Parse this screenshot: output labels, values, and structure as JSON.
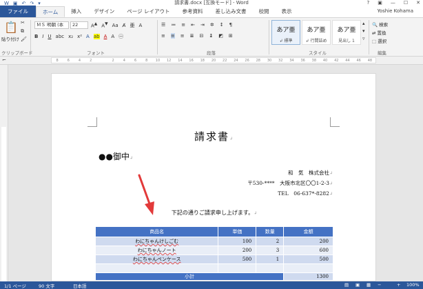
{
  "window": {
    "title": "請求書.docx [互換モード] - Word",
    "user": "Yoshie Kohama",
    "qat_icons": [
      "word-icon",
      "save-icon",
      "undo-icon",
      "redo-icon",
      "customize-icon"
    ],
    "buttons": {
      "help": "?",
      "ribbon_options": "▣",
      "minimize": "—",
      "maximize": "☐",
      "close": "✕"
    }
  },
  "ribbon": {
    "tabs": [
      "ファイル",
      "ホーム",
      "挿入",
      "デザイン",
      "ページ レイアウト",
      "参考資料",
      "差し込み文書",
      "校閲",
      "表示"
    ],
    "active_tab": "ホーム",
    "clipboard": {
      "paste_label": "貼り付け",
      "group_label": "クリップボード"
    },
    "font": {
      "name": "ＭＳ 明朝 (本",
      "size": "22",
      "group_label": "フォント"
    },
    "paragraph": {
      "group_label": "段落"
    },
    "styles": {
      "group_label": "スタイル",
      "items": [
        {
          "sample": "あア亜",
          "name": "↲ 標準"
        },
        {
          "sample": "あア亜",
          "name": "↲ 行間詰め"
        },
        {
          "sample": "あア亜",
          "name": "見出し 1"
        }
      ]
    },
    "editing": {
      "find": "検索",
      "replace": "置換",
      "select": "選択",
      "group_label": "編集"
    }
  },
  "ruler": {
    "ticks": [
      "8",
      "6",
      "4",
      "2",
      "",
      "2",
      "4",
      "6",
      "8",
      "10",
      "12",
      "14",
      "16",
      "18",
      "20",
      "22",
      "24",
      "26",
      "28",
      "30",
      "32",
      "34",
      "36",
      "38",
      "40",
      "42",
      "44",
      "46",
      "48"
    ]
  },
  "document": {
    "title": "請求書",
    "addressee": "●●御中",
    "sender_lines": [
      "和　気　株式会社",
      "〒530-****　大阪市北区〇〇1-2-3",
      "TEL　06-637*-8282"
    ],
    "greeting": "下記の通りご請求申し上げます。",
    "paragraph_mark": "↲",
    "table": {
      "headers": [
        "商品名",
        "単価",
        "数量",
        "金額"
      ],
      "rows": [
        [
          "わにちゃんけしごむ",
          "100",
          "2",
          "200"
        ],
        [
          "わにちゃんノート",
          "200",
          "3",
          "600"
        ],
        [
          "わにちゃんペンケース",
          "500",
          "1",
          "500"
        ]
      ],
      "total_label": "小計",
      "total_value": "1300"
    }
  },
  "status": {
    "page": "1/1 ページ",
    "words": "90 文字",
    "language": "日本語",
    "zoom": "100%"
  },
  "colors": {
    "accent": "#2b579a",
    "table_header": "#4472c4",
    "arrow": "#e23a3a"
  }
}
